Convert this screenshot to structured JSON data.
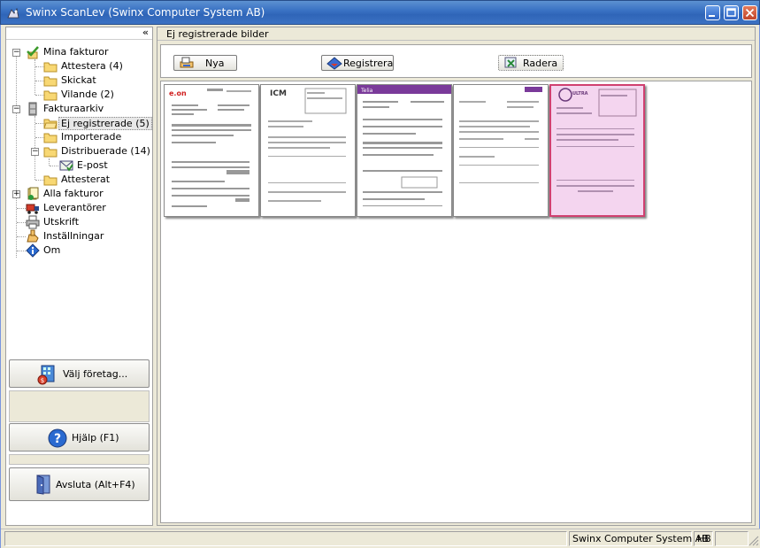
{
  "window": {
    "title": "Swinx ScanLev  (Swinx Computer System AB)"
  },
  "tree": {
    "mina_fakturor": "Mina fakturor",
    "attestera": "Attestera (4)",
    "skickat": "Skickat",
    "vilande": "Vilande (2)",
    "fakturaarkiv": "Fakturaarkiv",
    "ej_registrerade": "Ej registrerade (5)",
    "importerade": "Importerade",
    "distribuerade": "Distribuerade (14)",
    "epost": "E-post",
    "attesterat": "Attesterat",
    "alla_fakturor": "Alla fakturor",
    "leverantorer": "Leverantörer",
    "utskrift": "Utskrift",
    "installningar": "Inställningar",
    "om": "Om"
  },
  "buttons": {
    "valj_foretag": "Välj företag...",
    "hjalp": "Hjälp (F1)",
    "avsluta": "Avsluta (Alt+F4)"
  },
  "panel": {
    "header": "Ej registrerade bilder",
    "nya": "Nya",
    "registrera": "Registrera",
    "radera": "Radera"
  },
  "thumbnails": [
    {
      "logo": "e.on"
    },
    {
      "logo": "ICM"
    },
    {
      "logo": "Telia"
    },
    {
      "logo": ""
    },
    {
      "logo": "ULTRA"
    }
  ],
  "status": {
    "company": "Swinx Computer System AB",
    "user": "HB"
  },
  "colors": {
    "titlebar": "#3b73c4",
    "selected_thumb_border": "#d04070"
  }
}
